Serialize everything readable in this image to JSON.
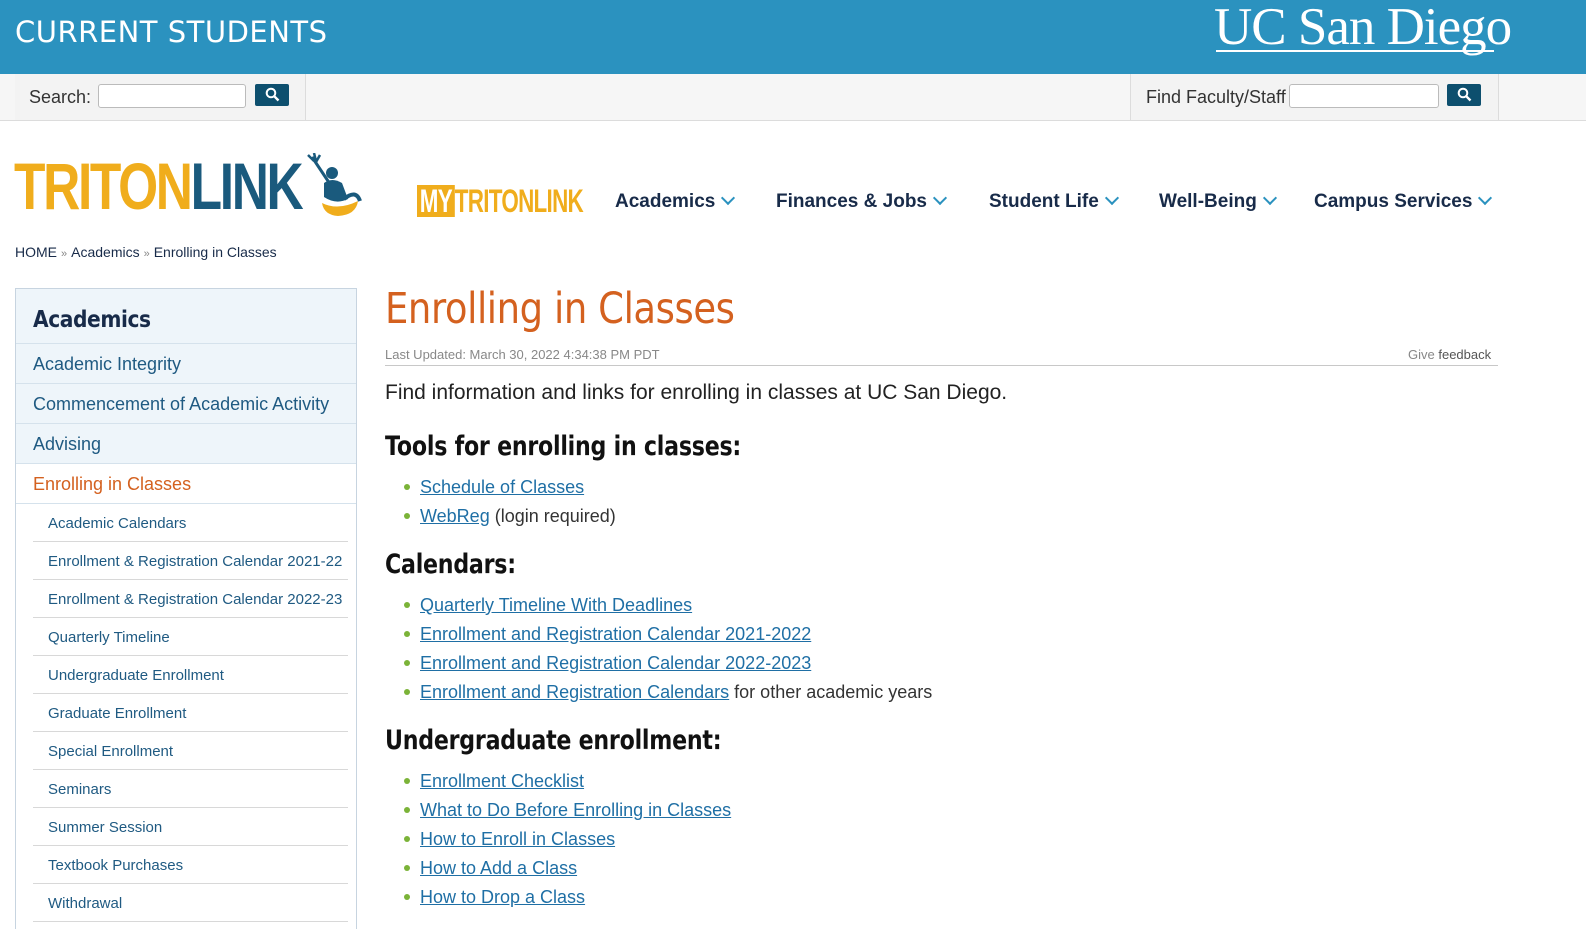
{
  "banner": {
    "title": "CURRENT STUDENTS",
    "logo_text": "UC San Diego"
  },
  "search": {
    "label": "Search:",
    "placeholder": ""
  },
  "faculty_search": {
    "label": "Find Faculty/Staff",
    "placeholder": ""
  },
  "header": {
    "logo_triton": "TRITON",
    "logo_link": "LINK",
    "my_prefix": "MY",
    "my_rest": "TRITONLINK",
    "nav": [
      "Academics",
      "Finances & Jobs",
      "Student Life",
      "Well-Being",
      "Campus Services"
    ]
  },
  "breadcrumb": [
    "HOME",
    "Academics",
    "Enrolling in Classes"
  ],
  "sidebar": {
    "heading": "Academics",
    "items": [
      "Academic Integrity",
      "Commencement of Academic Activity",
      "Advising"
    ],
    "active": "Enrolling in Classes",
    "subitems": [
      "Academic Calendars",
      "Enrollment & Registration Calendar 2021-22",
      "Enrollment & Registration Calendar 2022-23",
      "Quarterly Timeline",
      "Undergraduate Enrollment",
      "Graduate Enrollment",
      "Special Enrollment",
      "Seminars",
      "Summer Session",
      "Textbook Purchases",
      "Withdrawal"
    ]
  },
  "main": {
    "title": "Enrolling in Classes",
    "last_updated": "Last Updated: March 30, 2022 4:34:38 PM PDT",
    "feedback_prefix": "Give",
    "feedback_link": "feedback",
    "intro": "Find information and links for enrolling in classes at UC San Diego.",
    "sections": [
      {
        "heading": "Tools for enrolling in classes:",
        "links": [
          {
            "text": "Schedule of Classes",
            "suffix": ""
          },
          {
            "text": "WebReg",
            "suffix": " (login required)"
          }
        ]
      },
      {
        "heading": "Calendars:",
        "links": [
          {
            "text": "Quarterly Timeline With Deadlines",
            "suffix": ""
          },
          {
            "text": "Enrollment and Registration Calendar 2021-2022",
            "suffix": ""
          },
          {
            "text": "Enrollment and Registration Calendar 2022-2023",
            "suffix": ""
          },
          {
            "text": "Enrollment and Registration Calendars",
            "suffix": " for other academic years"
          }
        ]
      },
      {
        "heading": "Undergraduate enrollment:",
        "links": [
          {
            "text": "Enrollment Checklist",
            "suffix": ""
          },
          {
            "text": "What to Do Before Enrolling in Classes",
            "suffix": ""
          },
          {
            "text": "How to Enroll in Classes",
            "suffix": ""
          },
          {
            "text": "How to Add a Class",
            "suffix": ""
          },
          {
            "text": "How to Drop a Class",
            "suffix": ""
          }
        ]
      }
    ]
  },
  "colors": {
    "banner": "#2b92bf",
    "title_orange": "#d4611f",
    "navy": "#182B49",
    "gold": "#f0ad1c",
    "bullet_green": "#7bb338"
  }
}
